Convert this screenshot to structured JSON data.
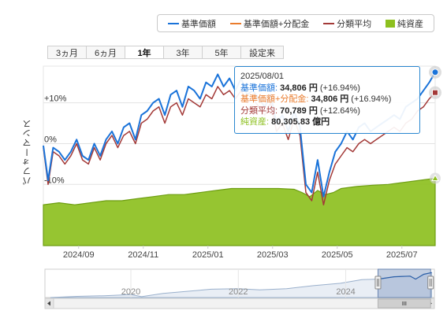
{
  "legend": {
    "items": [
      {
        "label": "基準価額",
        "color": "#1a73d9",
        "kind": "line"
      },
      {
        "label": "基準価額+分配金",
        "color": "#ea7c2d",
        "kind": "line"
      },
      {
        "label": "分類平均",
        "color": "#a33a38",
        "kind": "line"
      },
      {
        "label": "純資産",
        "color": "#8dc01f",
        "kind": "box"
      }
    ]
  },
  "range_buttons": [
    {
      "label": "3ヵ月",
      "active": false
    },
    {
      "label": "6ヵ月",
      "active": false
    },
    {
      "label": "1年",
      "active": true
    },
    {
      "label": "3年",
      "active": false
    },
    {
      "label": "5年",
      "active": false
    },
    {
      "label": "設定来",
      "active": false
    }
  ],
  "y_axis_title": "パフォーマンス",
  "tooltip": {
    "date": "2025/08/01",
    "rows": [
      {
        "label": "基準価額: ",
        "value": "34,806 円",
        "change": " (+16.94%)",
        "color": "#1a73d9"
      },
      {
        "label": "基準価額+分配金: ",
        "value": "34,806 円",
        "change": " (+16.94%)",
        "color": "#ea7c2d"
      },
      {
        "label": "分類平均: ",
        "value": "70,789 円",
        "change": " (+12.64%)",
        "color": "#a33a38"
      },
      {
        "label": "純資産: ",
        "value": "80,305.83 億円",
        "change": "",
        "color": "#8dc01f"
      }
    ]
  },
  "navigator": {
    "labels": [
      "2020",
      "2022",
      "2024"
    ],
    "label_years": [
      2020,
      2022,
      2024
    ],
    "range_start_year": 2018.4,
    "range_end_year": 2025.65,
    "selected_start_year": 2024.6,
    "selected_end_year": 2025.58,
    "series": [
      {
        "year": 2018.5,
        "v": 0
      },
      {
        "year": 2019.0,
        "v": 4
      },
      {
        "year": 2019.5,
        "v": 6
      },
      {
        "year": 2020.0,
        "v": 10
      },
      {
        "year": 2020.2,
        "v": 3
      },
      {
        "year": 2020.6,
        "v": 14
      },
      {
        "year": 2021.0,
        "v": 20
      },
      {
        "year": 2021.5,
        "v": 28
      },
      {
        "year": 2022.0,
        "v": 30
      },
      {
        "year": 2022.4,
        "v": 26
      },
      {
        "year": 2022.9,
        "v": 30
      },
      {
        "year": 2023.4,
        "v": 40
      },
      {
        "year": 2023.9,
        "v": 48
      },
      {
        "year": 2024.3,
        "v": 60
      },
      {
        "year": 2024.6,
        "v": 62
      },
      {
        "year": 2024.9,
        "v": 70
      },
      {
        "year": 2025.2,
        "v": 72
      },
      {
        "year": 2025.3,
        "v": 62
      },
      {
        "year": 2025.45,
        "v": 78
      },
      {
        "year": 2025.6,
        "v": 84
      }
    ]
  },
  "chart_data": {
    "type": "line",
    "x_ticks": [
      "2024/09",
      "2024/11",
      "2025/01",
      "2025/03",
      "2025/05",
      "2025/07"
    ],
    "x_tick_pos": [
      0.09,
      0.255,
      0.42,
      0.585,
      0.75,
      0.915
    ],
    "y_ticks": [
      "+10%",
      "0%",
      "-10%"
    ],
    "y_tick_values": [
      10,
      0,
      -10
    ],
    "ylim": [
      -25,
      19
    ],
    "ylabel": "パフォーマンス",
    "series": [
      {
        "name": "基準価額",
        "color": "#1a73d9",
        "t": [
          0.0,
          0.012,
          0.025,
          0.04,
          0.055,
          0.07,
          0.085,
          0.1,
          0.115,
          0.13,
          0.145,
          0.16,
          0.175,
          0.19,
          0.205,
          0.22,
          0.235,
          0.25,
          0.265,
          0.28,
          0.295,
          0.31,
          0.325,
          0.34,
          0.355,
          0.37,
          0.385,
          0.4,
          0.415,
          0.43,
          0.445,
          0.46,
          0.475,
          0.49,
          0.505,
          0.52,
          0.535,
          0.55,
          0.565,
          0.58,
          0.595,
          0.61,
          0.625,
          0.64,
          0.655,
          0.67,
          0.685,
          0.7,
          0.715,
          0.73,
          0.745,
          0.76,
          0.775,
          0.79,
          0.805,
          0.82,
          0.835,
          0.85,
          0.865,
          0.88,
          0.895,
          0.91,
          0.925,
          0.94,
          0.955,
          0.97,
          0.985,
          1.0
        ],
        "v": [
          -0.5,
          -9,
          -1,
          -2,
          -4,
          -2,
          1,
          -3,
          -4,
          0,
          -3,
          1,
          3,
          0,
          4,
          5,
          1,
          7,
          8,
          10,
          11,
          7,
          12,
          13,
          9,
          14,
          13,
          11,
          15,
          14,
          17,
          14,
          16,
          13,
          16,
          12,
          13,
          11,
          9,
          12,
          5,
          7,
          3,
          8,
          4,
          -10,
          -12,
          -4,
          -13,
          -7,
          -2,
          0,
          3,
          1,
          4,
          5,
          3,
          4,
          5,
          6,
          7,
          6,
          9,
          10,
          11,
          13,
          15,
          17.5
        ]
      },
      {
        "name": "分類平均",
        "color": "#a33a38",
        "t": [
          0.0,
          0.012,
          0.025,
          0.04,
          0.055,
          0.07,
          0.085,
          0.1,
          0.115,
          0.13,
          0.145,
          0.16,
          0.175,
          0.19,
          0.205,
          0.22,
          0.235,
          0.25,
          0.265,
          0.28,
          0.295,
          0.31,
          0.325,
          0.34,
          0.355,
          0.37,
          0.385,
          0.4,
          0.415,
          0.43,
          0.445,
          0.46,
          0.475,
          0.49,
          0.505,
          0.52,
          0.535,
          0.55,
          0.565,
          0.58,
          0.595,
          0.61,
          0.625,
          0.64,
          0.655,
          0.67,
          0.685,
          0.7,
          0.715,
          0.73,
          0.745,
          0.76,
          0.775,
          0.79,
          0.805,
          0.82,
          0.835,
          0.85,
          0.865,
          0.88,
          0.895,
          0.91,
          0.925,
          0.94,
          0.955,
          0.97,
          0.985,
          1.0
        ],
        "v": [
          -1,
          -10,
          -2,
          -3,
          -5,
          -3,
          0,
          -4,
          -5,
          -1,
          -4,
          0,
          2,
          -1,
          2,
          3,
          0,
          5,
          6,
          8,
          9,
          5,
          9,
          10,
          7,
          11,
          10,
          9,
          12,
          11,
          14,
          12,
          13,
          11,
          13,
          10,
          11,
          9,
          7,
          10,
          3,
          5,
          1,
          6,
          2,
          -12,
          -14,
          -7,
          -15,
          -9,
          -5,
          -3,
          -1,
          -2,
          0,
          1,
          0,
          1,
          2,
          3,
          4,
          3,
          5,
          6,
          8,
          9,
          11,
          12.5
        ]
      },
      {
        "name": "純資産",
        "color": "#8dc01f",
        "t": [
          0.0,
          0.04,
          0.08,
          0.12,
          0.16,
          0.2,
          0.24,
          0.28,
          0.32,
          0.36,
          0.4,
          0.44,
          0.48,
          0.52,
          0.56,
          0.6,
          0.64,
          0.66,
          0.68,
          0.7,
          0.72,
          0.74,
          0.76,
          0.8,
          0.84,
          0.88,
          0.92,
          0.96,
          1.0
        ],
        "v": [
          -15,
          -14.5,
          -15,
          -14.5,
          -14,
          -14,
          -13.5,
          -13,
          -12.5,
          -12.5,
          -12,
          -11.5,
          -11,
          -11,
          -11,
          -11,
          -11.2,
          -12,
          -13,
          -11.5,
          -12.5,
          -12,
          -11,
          -10.5,
          -10.2,
          -10,
          -9.5,
          -9,
          -8.5
        ]
      }
    ]
  }
}
